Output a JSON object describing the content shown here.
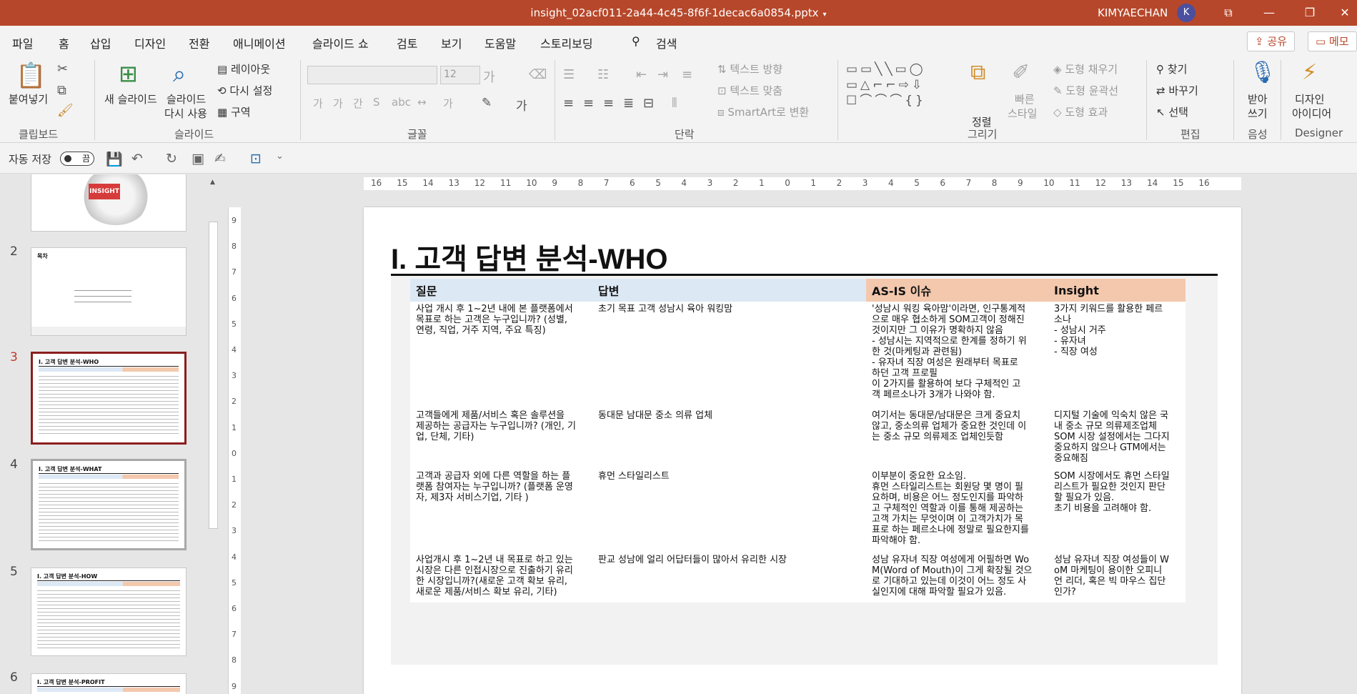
{
  "titlebar": {
    "filename": "insight_02acf011-2a44-4c45-8f6f-1decac6a0854.pptx",
    "user": "KIMYAECHAN",
    "avatar": "K"
  },
  "menu": {
    "tabs": [
      "파일",
      "홈",
      "삽입",
      "디자인",
      "전환",
      "애니메이션",
      "슬라이드 쇼",
      "검토",
      "보기",
      "도움말",
      "스토리보딩"
    ],
    "search": "검색",
    "share": "공유",
    "comment": "메모"
  },
  "ribbon": {
    "clipboard": {
      "paste": "붙여넣기",
      "label": "클립보드"
    },
    "slides": {
      "new_line1": "새 슬라이드",
      "reuse_line1": "슬라이드",
      "reuse_line2": "다시 사용",
      "layout": "레이아웃",
      "reset": "다시 설정",
      "section": "구역",
      "label": "슬라이드"
    },
    "font": {
      "size": "12",
      "label": "글꼴"
    },
    "paragraph": {
      "text_direction": "텍스트 방향",
      "align_text": "텍스트 맞춤",
      "smartart": "SmartArt로 변환",
      "label": "단락"
    },
    "drawing": {
      "arrange": "정렬",
      "quick1": "빠른",
      "quick2": "스타일",
      "fill": "도형 채우기",
      "outline": "도형 윤곽선",
      "effects": "도형 효과",
      "label": "그리기"
    },
    "editing": {
      "find": "찾기",
      "replace": "바꾸기",
      "select": "선택",
      "label": "편집"
    },
    "voice": {
      "dictate1": "받아",
      "dictate2": "쓰기",
      "label": "음성"
    },
    "designer": {
      "ideas1": "디자인",
      "ideas2": "아이디어",
      "label": "Designer"
    }
  },
  "qat": {
    "autosave": "자동 저장",
    "toggle": "끔"
  },
  "thumbnails": [
    {
      "num": "",
      "title": "INSIGHT"
    },
    {
      "num": "2",
      "title": "목차"
    },
    {
      "num": "3",
      "title": "I. 고객 답변 분석-WHO"
    },
    {
      "num": "4",
      "title": "I. 고객 답변 분석-WHAT"
    },
    {
      "num": "5",
      "title": "I. 고객 답변 분석-HOW"
    },
    {
      "num": "6",
      "title": "I. 고객 답변 분석-PROFIT"
    }
  ],
  "slide": {
    "title": "I. 고객 답변 분석-WHO",
    "headers": [
      "질문",
      "답변",
      "AS-IS 이슈",
      "Insight"
    ],
    "rows": [
      [
        "사업 개시 후 1~2년 내에 본 플랫폼에서\n목표로 하는 고객은 누구입니까? (성별,\n연령, 직업, 거주 지역, 주요 특징)",
        "초기 목표 고객 성남시 육아 워킹맘",
        "'성남시 워킹 육아맘'이라면, 인구통계적\n으로 매우 협소하게 SOM고객이 정해진\n것이지만 그 이유가 명확하지 않음\n - 성남시는 지역적으로 한계를 정하기 위\n한 것(마케팅과 관련됨)\n - 유자녀 직장 여성은 원래부터 목표로\n하던 고객 프로필\n 이 2가지를 활용하여 보다 구체적인 고\n객 페르소나가 3개가 나와야 함.",
        "3가지 키워드를 활용한 페르\n소나\n - 성남시 거주\n - 유자녀\n - 직장 여성"
      ],
      [
        "고객들에게 제품/서비스 혹은 솔루션을\n제공하는 공급자는 누구입니까? (개인, 기\n업, 단체, 기타)",
        "동대문 남대문 중소 의류 업체",
        " 여기서는 동대문/남대문은 크게 중요치\n않고, 중소의류 업체가 중요한 것인데 이\n는 중소 규모 의류제조 업체인듯함",
        "디지털 기술에 익숙치 않은 국\n내 중소 규모 의류제조업체\nSOM 시장 설정에서는 그다지\n중요하지 않으나 GTM에서는\n중요해짐"
      ],
      [
        "고객과 공급자 외에 다른 역할을 하는 플\n랫폼 참여자는 누구입니까? (플랫폼 운영\n자, 제3자 서비스기업, 기타 )",
        "휴먼 스타일리스트",
        "이부분이 중요한 요소임.\n휴먼 스타일리스트는 회원당 몇 명이 필\n요하며, 비용은 어느 정도인지를 파악하\n고 구체적인 역할과 이를 통해 제공하는\n고객 가치는 무엇이며 이 고객가치가  목\n표로 하는 페르소나에 정말로 필요한지를\n파악해야 함.",
        "SOM 시장에서도 휴먼 스타일\n리스트가 필요한 것인지 판단\n할 필요가 있음.\n초기 비용을 고려해야 함."
      ],
      [
        "사업개시 후 1~2년 내 목표로 하고 있는\n시장은 다른 인접시장으로 진출하기 유리\n한 시장입니까?(새로운 고객 확보 유리,\n새로운 제품/서비스 확보 유리, 기타)",
        "판교 성남에 얼리 어답터들이 많아서 유리한 시장",
        "성남 유자녀 직장 여성에게 어필하면 Wo\nM(Word of Mouth)이 그게 확장될 것으\n로 기대하고 있는데 이것이 어느 정도 사\n실인지에 대해 파악할 필요가 있음.",
        "성남 유자녀 직장 여성들이 W\noM 마케팅이 용이한 오피니\n언 리더, 혹은 빅 마우스 집단\n인가?"
      ]
    ]
  },
  "rulers": {
    "h": [
      "16",
      "15",
      "14",
      "13",
      "12",
      "11",
      "10",
      "9",
      "8",
      "7",
      "6",
      "5",
      "4",
      "3",
      "2",
      "1",
      "0",
      "1",
      "2",
      "3",
      "4",
      "5",
      "6",
      "7",
      "8",
      "9",
      "10",
      "11",
      "12",
      "13",
      "14",
      "15",
      "16"
    ],
    "v": [
      "9",
      "8",
      "7",
      "6",
      "5",
      "4",
      "3",
      "2",
      "1",
      "0",
      "1",
      "2",
      "3",
      "4",
      "5",
      "6",
      "7",
      "8",
      "9"
    ]
  }
}
